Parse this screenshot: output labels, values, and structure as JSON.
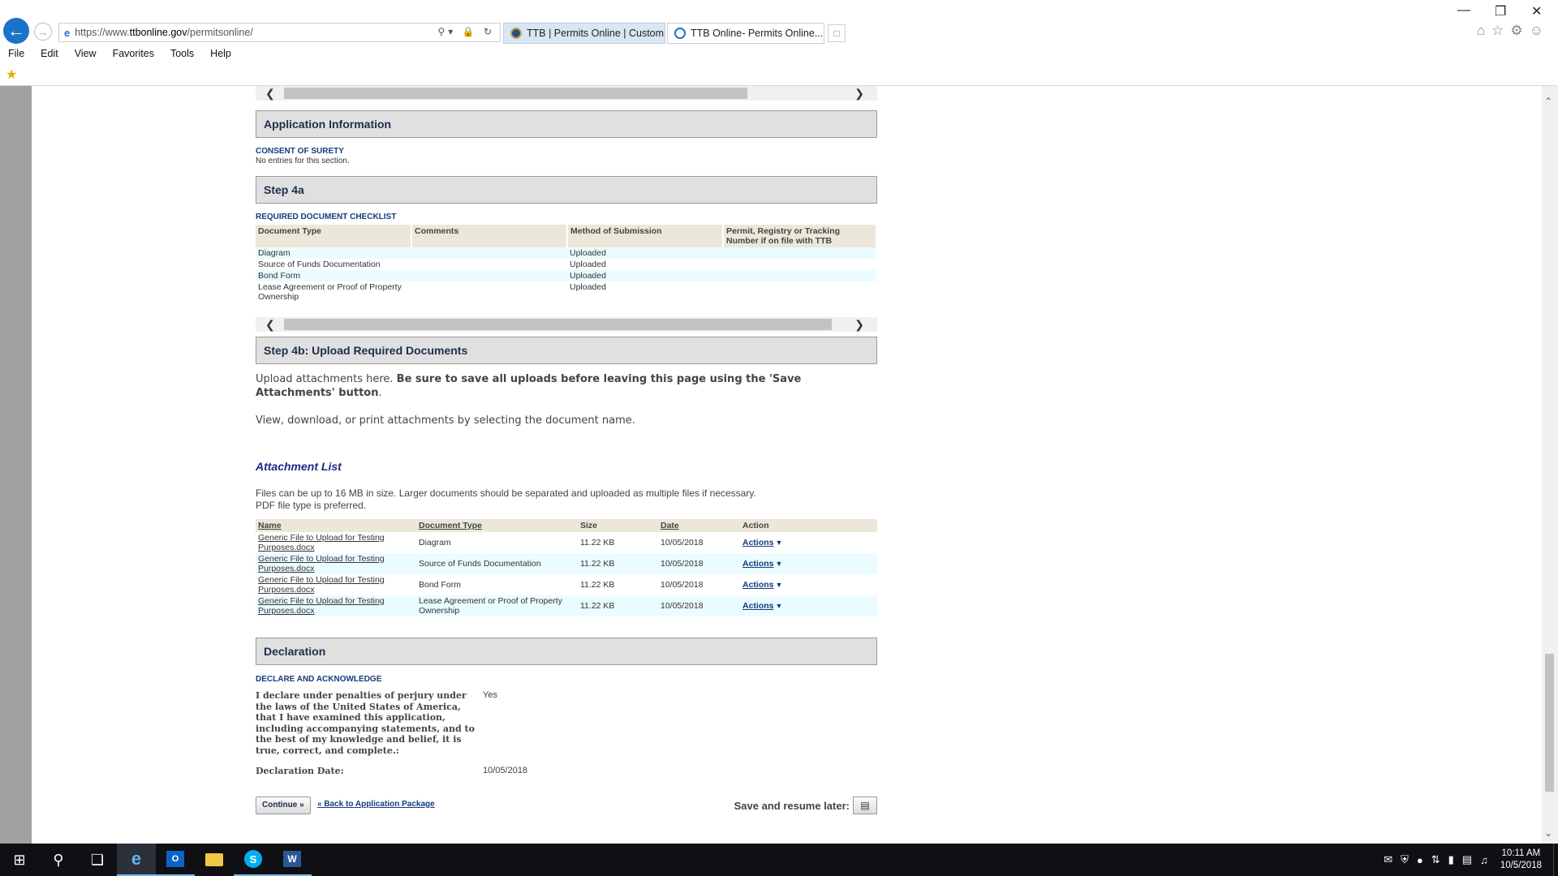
{
  "browser": {
    "url_prefix": "https://www.",
    "url_domain": "ttbonline.gov",
    "url_path": "/permitsonline/",
    "tabs": [
      {
        "label": "TTB | Permits Online | Custom...",
        "active": true
      },
      {
        "label": "TTB Online- Permits Online...",
        "active": false
      }
    ],
    "menu": [
      "File",
      "Edit",
      "View",
      "Favorites",
      "Tools",
      "Help"
    ]
  },
  "sections": {
    "application_info": {
      "title": "Application Information",
      "sub_title": "CONSENT OF SURETY",
      "empty_text": "No entries for this section."
    },
    "step4a": {
      "title": "Step 4a",
      "sub_title": "REQUIRED DOCUMENT CHECKLIST",
      "columns": [
        "Document Type",
        "Comments",
        "Method of Submission",
        "Permit, Registry or Tracking Number if on file with TTB"
      ],
      "rows": [
        {
          "type": "Diagram",
          "comments": "",
          "method": "Uploaded",
          "permit": ""
        },
        {
          "type": "Source of Funds Documentation",
          "comments": "",
          "method": "Uploaded",
          "permit": ""
        },
        {
          "type": "Bond Form",
          "comments": "",
          "method": "Uploaded",
          "permit": ""
        },
        {
          "type": "Lease Agreement or Proof of Property Ownership",
          "comments": "",
          "method": "Uploaded",
          "permit": ""
        }
      ]
    },
    "step4b": {
      "title": "Step 4b: Upload Required Documents",
      "intro_normal": "Upload attachments here. ",
      "intro_bold": "Be sure to save all uploads before leaving this page using the 'Save Attachments' button",
      "intro_end": ".",
      "view_text": "View, download, or print attachments by selecting the document name."
    },
    "attachments": {
      "title": "Attachment List",
      "files_line1": "Files can be up to 16 MB in size. Larger documents should be separated and uploaded as multiple files if necessary.",
      "files_line2": "PDF file type is preferred.",
      "columns": [
        "Name",
        "Document Type",
        "Size",
        "Date",
        "Action"
      ],
      "rows": [
        {
          "name": "Generic File to Upload for Testing Purposes.docx",
          "doc_type": "Diagram",
          "size": "11.22 KB",
          "date": "10/05/2018",
          "action": "Actions"
        },
        {
          "name": "Generic File to Upload for Testing Purposes.docx",
          "doc_type": "Source of Funds Documentation",
          "size": "11.22 KB",
          "date": "10/05/2018",
          "action": "Actions"
        },
        {
          "name": "Generic File to Upload for Testing Purposes.docx",
          "doc_type": "Bond Form",
          "size": "11.22 KB",
          "date": "10/05/2018",
          "action": "Actions"
        },
        {
          "name": "Generic File to Upload for Testing Purposes.docx",
          "doc_type": "Lease Agreement or Proof of Property Ownership",
          "size": "11.22 KB",
          "date": "10/05/2018",
          "action": "Actions"
        }
      ]
    },
    "declaration": {
      "title": "Declaration",
      "sub_title": "DECLARE AND ACKNOWLEDGE",
      "statement": "I declare under penalties of perjury under the laws of the United States of America, that I have examined this application, including accompanying statements, and to the best of my knowledge and belief, it is true, correct, and complete.:",
      "statement_answer": "Yes",
      "date_label": "Declaration Date:",
      "date_value": "10/05/2018"
    }
  },
  "footer": {
    "continue_label": "Continue »",
    "back_link": "« Back to Application Package",
    "save_later_label": "Save and resume later:"
  },
  "taskbar": {
    "time": "10:11 AM",
    "date": "10/5/2018"
  },
  "scroll": {
    "top_hscroll_thumb_fraction": 0.82,
    "mid_hscroll_thumb_fraction": 0.97
  }
}
